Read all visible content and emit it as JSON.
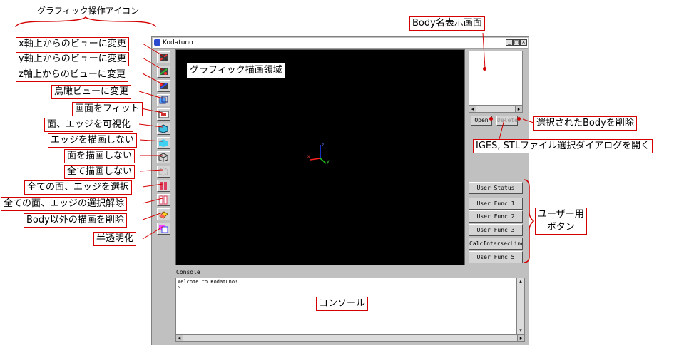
{
  "header_label": "グラフィック操作アイコン",
  "window": {
    "title": "Kodatuno",
    "minimize": "_",
    "maximize": "□",
    "close": "×"
  },
  "annotations": {
    "x_view": "x軸上からのビューに変更",
    "y_view": "y軸上からのビューに変更",
    "z_view": "z軸上からのビューに変更",
    "bird_view": "鳥瞰ビューに変更",
    "fit": "画面をフィット",
    "visualize": "面、エッジを可視化",
    "no_edge": "エッジを描画しない",
    "no_face": "面を描画しない",
    "no_all": "全て描画しない",
    "select_all": "全ての面、エッジを選択",
    "deselect_all": "全ての面、エッジの選択解除",
    "delete_nonbody": "Body以外の描画を削除",
    "semitransparent": "半透明化",
    "graphics_area": "グラフィック描画領域",
    "body_name": "Body名表示画面",
    "delete_selected": "選択されたBodyを削除",
    "open_dialog": "IGES, STLファイル選択ダイアログを開く",
    "user_buttons_line1": "ユーザー用",
    "user_buttons_line2": "ボタン",
    "console": "コンソール"
  },
  "buttons": {
    "open": "Open",
    "delete": "Delete",
    "user_status": "User Status",
    "user_func_1": "User Func 1",
    "user_func_2": "User Func 2",
    "user_func_3": "User Func 3",
    "calc_intersec_line": "CalcIntersecLine",
    "user_func_5": "User Func 5"
  },
  "console": {
    "label": "Console",
    "line1": "Welcome to Kodatuno!",
    "line2": ">"
  },
  "axes": {
    "x": "x",
    "y": "y",
    "z": "z"
  },
  "colors": {
    "callout_border": "#d40000",
    "graphics_bg": "#000000",
    "x_axis": "#ff2020",
    "y_axis": "#20c020",
    "z_axis": "#2040ff"
  }
}
